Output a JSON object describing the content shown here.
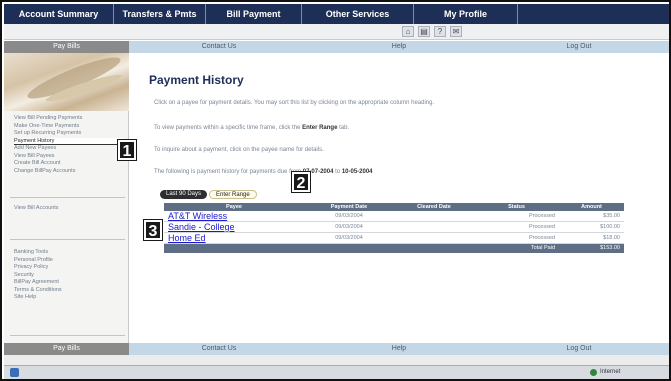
{
  "top_nav": [
    "Account Summary",
    "Transfers & Pmts",
    "Bill Payment",
    "Other Services",
    "My Profile",
    ""
  ],
  "toolbar_icons": [
    "home-icon",
    "print-icon",
    "help-icon",
    "mail-icon"
  ],
  "sub_nav": {
    "left": "Pay Bills",
    "links": [
      "Contact Us",
      "Help",
      "Log Out"
    ]
  },
  "sidebar": {
    "group1": [
      "View Bill Pending Payments",
      "Make One-Time Payments",
      "Set up Recurring Payments",
      "Payment History",
      "Add New Payees",
      "View Bill Payees",
      "Create Bill Account",
      "Change BillPay Accounts"
    ],
    "group2": [
      "View Bill Accounts"
    ],
    "group3": [
      "Banking Tools",
      "Personal Profile",
      "Privacy Policy",
      "Security",
      "BillPay Agreement",
      "Terms & Conditions",
      "Site Help"
    ]
  },
  "main": {
    "title": "Payment History",
    "instructions": [
      "Click on a payee for payment details. You may sort this list by clicking on the appropriate column heading.",
      "To view payments within a specific time frame, click the",
      "To inquire about a payment, click on the payee name for details.",
      "The following is payment history for payments due from"
    ],
    "enter_range_label": "Enter Range",
    "instr2_suffix": "tab.",
    "date_from": "07-07-2004",
    "date_to": "10-05-2004",
    "date_join": "to",
    "tabs": [
      "Last 90 Days",
      "Enter Range"
    ],
    "columns": [
      "Payee",
      "Payment Date",
      "Cleared Date",
      "Status",
      "Amount"
    ],
    "rows": [
      {
        "payee": "AT&T Wireless",
        "date": "09/03/2004",
        "cleared": "",
        "status": "Processed",
        "amount": "$35.00"
      },
      {
        "payee": "Sandie - College",
        "date": "09/03/2004",
        "cleared": "",
        "status": "Processed",
        "amount": "$100.00"
      },
      {
        "payee": "Home Ed",
        "date": "09/03/2004",
        "cleared": "",
        "status": "Processed",
        "amount": "$18.00"
      }
    ],
    "total_label": "Total Paid",
    "total_value": "$153.00"
  },
  "callouts": [
    "1",
    "2",
    "3"
  ],
  "status_bar": {
    "zone": "Internet"
  }
}
